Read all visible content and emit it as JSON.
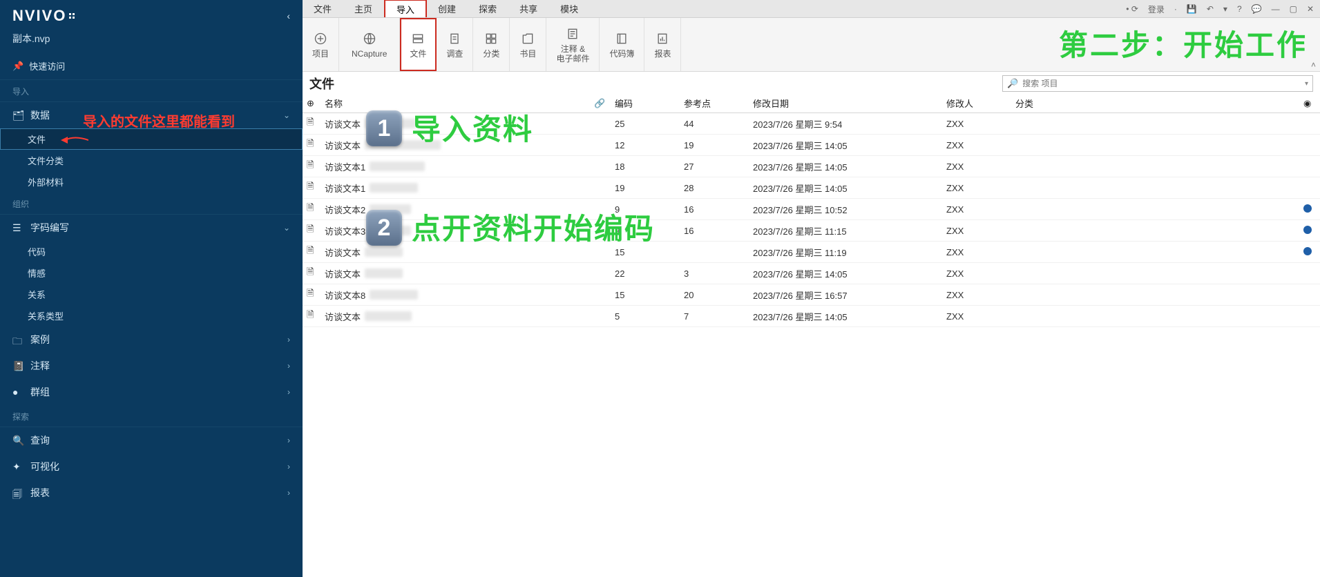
{
  "app": {
    "logo": "NVIVO",
    "project_file": "副本.nvp"
  },
  "sidebar": {
    "quick_access": "快速访问",
    "sections": {
      "import": "导入",
      "organize": "组织",
      "explore": "探索"
    },
    "data": {
      "label": "数据",
      "files": "文件",
      "file_class": "文件分类",
      "external": "外部材料"
    },
    "coding": {
      "label": "字码编写",
      "codes": "代码",
      "sentiment": "情感",
      "relations": "关系",
      "rel_types": "关系类型"
    },
    "cases": "案例",
    "annotations": "注释",
    "sets": "群组",
    "queries": "查询",
    "vis": "可视化",
    "reports": "报表"
  },
  "menubar": {
    "file": "文件",
    "home": "主页",
    "import": "导入",
    "create": "创建",
    "explore": "探索",
    "share": "共享",
    "module": "模块"
  },
  "titlebar": {
    "login": "登录"
  },
  "ribbon": {
    "project": "项目",
    "ncapture": "NCapture",
    "files": "文件",
    "survey": "调查",
    "classify": "分类",
    "bookmarks": "书目",
    "notes": "注释 &\n电子邮件",
    "codebook": "代码簿",
    "report": "报表"
  },
  "annotations": {
    "sidebar_hint": "导入的文件这里都能看到",
    "step_banner": "第二步：开始工作",
    "step1_text": "导入资料",
    "step2_text": "点开资料开始编码",
    "badge1": "1",
    "badge2": "2"
  },
  "content": {
    "title": "文件",
    "search_placeholder": "搜索 项目",
    "columns": {
      "name": "名称",
      "code": "编码",
      "ref": "参考点",
      "modified": "修改日期",
      "by": "修改人",
      "class": "分类"
    },
    "rows": [
      {
        "name": "访谈文本",
        "code": "25",
        "ref": "44",
        "modified": "2023/7/26 星期三 9:54",
        "by": "ZXX",
        "dot": false,
        "blur_w": 74
      },
      {
        "name": "访谈文本",
        "code": "12",
        "ref": "19",
        "modified": "2023/7/26 星期三 14:05",
        "by": "ZXX",
        "dot": false,
        "blur_w": 110
      },
      {
        "name": "访谈文本1",
        "code": "18",
        "ref": "27",
        "modified": "2023/7/26 星期三 14:05",
        "by": "ZXX",
        "dot": false,
        "blur_w": 80
      },
      {
        "name": "访谈文本1",
        "code": "19",
        "ref": "28",
        "modified": "2023/7/26 星期三 14:05",
        "by": "ZXX",
        "dot": false,
        "blur_w": 70
      },
      {
        "name": "访谈文本2",
        "code": "9",
        "ref": "16",
        "modified": "2023/7/26 星期三 10:52",
        "by": "ZXX",
        "dot": true,
        "blur_w": 60
      },
      {
        "name": "访谈文本3",
        "code": "9",
        "ref": "16",
        "modified": "2023/7/26 星期三 11:15",
        "by": "ZXX",
        "dot": true,
        "blur_w": 60
      },
      {
        "name": "访谈文本",
        "code": "15",
        "ref": "",
        "modified": "2023/7/26 星期三 11:19",
        "by": "ZXX",
        "dot": true,
        "blur_w": 55
      },
      {
        "name": "访谈文本",
        "code": "22",
        "ref": "3",
        "modified": "2023/7/26 星期三 14:05",
        "by": "ZXX",
        "dot": false,
        "blur_w": 55
      },
      {
        "name": "访谈文本8",
        "code": "15",
        "ref": "20",
        "modified": "2023/7/26 星期三 16:57",
        "by": "ZXX",
        "dot": false,
        "blur_w": 70
      },
      {
        "name": "访谈文本",
        "code": "5",
        "ref": "7",
        "modified": "2023/7/26 星期三 14:05",
        "by": "ZXX",
        "dot": false,
        "blur_w": 68
      }
    ]
  }
}
